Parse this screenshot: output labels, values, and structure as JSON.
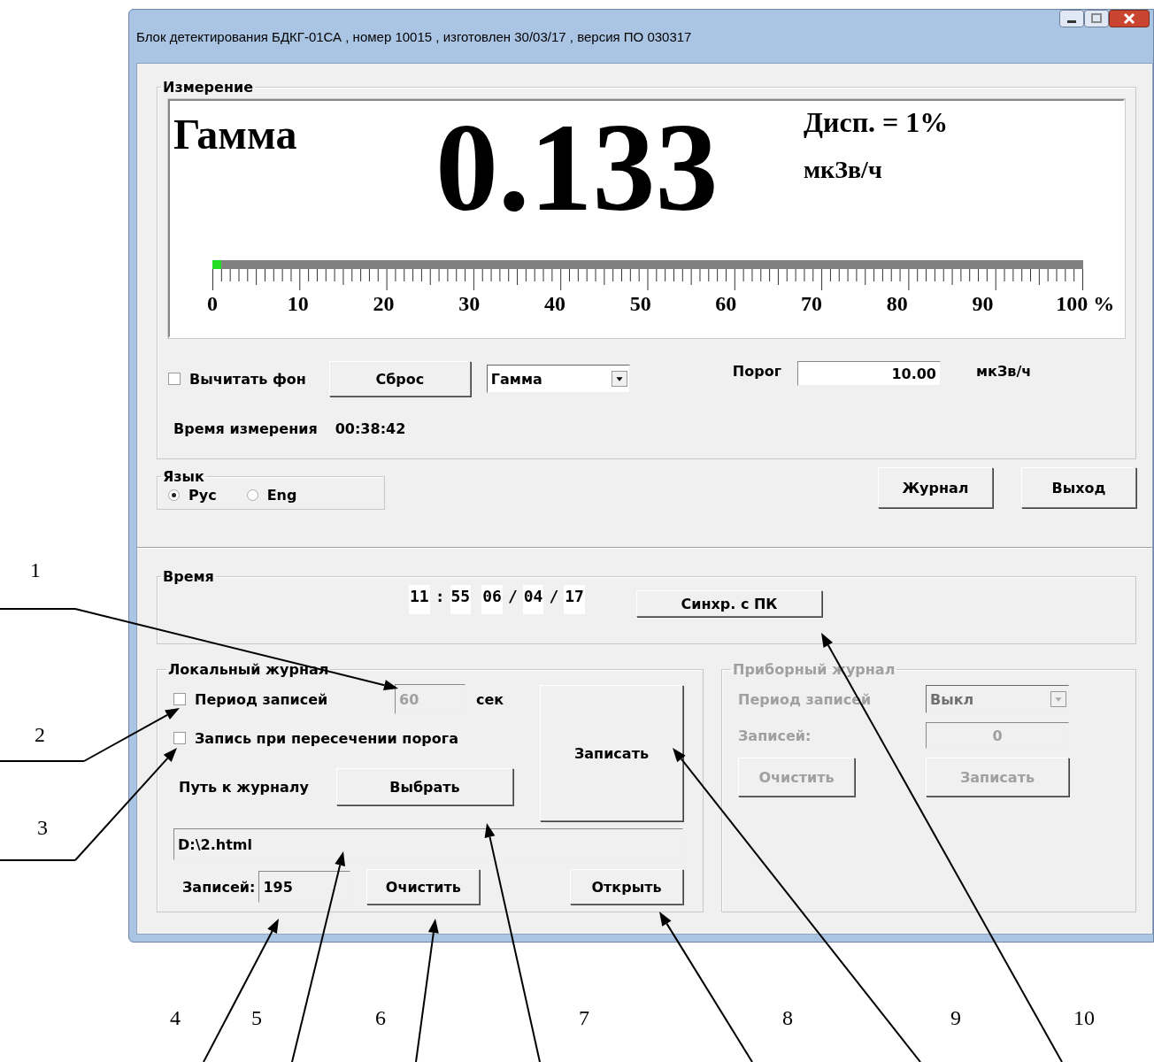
{
  "window": {
    "title": "Блок детектирования БДКГ-01СА , номер 10015 , изготовлен 30/03/17 , версия ПО 030317"
  },
  "measurement": {
    "title": "Измерение",
    "display": {
      "mode": "Гамма",
      "value": "0.133",
      "dispersion": "Дисп. = 1%",
      "unit": "мкЗв/ч",
      "scale": {
        "level": 0.01,
        "ticks": [
          "0",
          "10",
          "20",
          "30",
          "40",
          "50",
          "60",
          "70",
          "80",
          "90",
          "100 %"
        ]
      }
    },
    "subtract_background": {
      "label": "Вычитать фон",
      "checked": false
    },
    "reset_button": "Сброс",
    "mode_select": {
      "value": "Гамма"
    },
    "threshold": {
      "label": "Порог",
      "value": "10.00",
      "unit": "мкЗв/ч"
    },
    "measurement_time": {
      "label": "Время измерения",
      "value": "00:38:42"
    }
  },
  "language": {
    "title": "Язык",
    "options": [
      {
        "label": "Рус",
        "selected": true
      },
      {
        "label": "Eng",
        "selected": false
      }
    ]
  },
  "buttons": [
    "Журнал",
    "Выход"
  ],
  "time": {
    "title": "Время",
    "parts": [
      {
        "kind": "value",
        "text": "11"
      },
      {
        "kind": "sep",
        "text": ":"
      },
      {
        "kind": "value",
        "text": "55"
      },
      {
        "kind": "value",
        "text": "06"
      },
      {
        "kind": "sep",
        "text": "/"
      },
      {
        "kind": "value",
        "text": "04"
      },
      {
        "kind": "sep",
        "text": "/"
      },
      {
        "kind": "value",
        "text": "17"
      }
    ],
    "sync_button": "Синхр. с ПК"
  },
  "local_log": {
    "title": "Локальный журнал",
    "period": {
      "label": "Период записей",
      "checked": false,
      "value": "60",
      "disabled": true,
      "unit": "сек"
    },
    "threshold_record": {
      "label": "Запись при пересечении порога",
      "checked": false
    },
    "write_button": "Записать",
    "path_label": "Путь к журналу",
    "choose_button": "Выбрать",
    "path": "D:\\2.html",
    "records_label": "Записей:",
    "records": "195",
    "clear_button": "Очистить",
    "open_button": "Открыть"
  },
  "device_log": {
    "title": "Приборный журнал",
    "disabled": true,
    "period_label": "Период записей",
    "period_value": "Выкл",
    "records_label": "Записей:",
    "records": "0",
    "clear_button": "Очистить",
    "write_button": "Записать"
  },
  "callouts": [
    {
      "label": "1"
    },
    {
      "label": "2"
    },
    {
      "label": "3"
    },
    {
      "label": "4"
    },
    {
      "label": "5"
    },
    {
      "label": "6"
    },
    {
      "label": "7"
    },
    {
      "label": "8"
    },
    {
      "label": "9"
    },
    {
      "label": "10"
    }
  ]
}
